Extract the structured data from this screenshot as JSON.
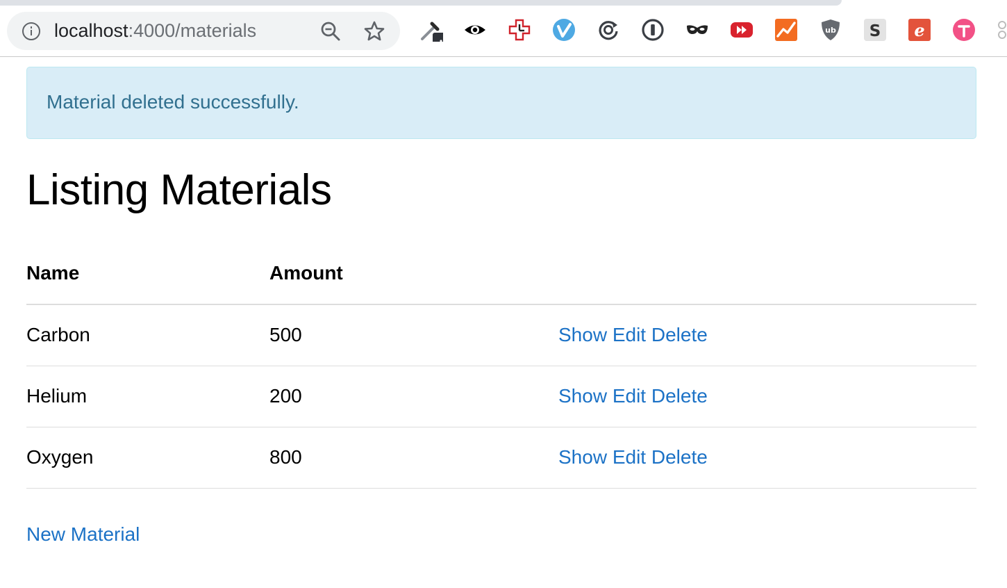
{
  "browser": {
    "url_host": "localhost",
    "url_path": ":4000/materials",
    "extensions": [
      "eyedropper-icon",
      "eye-icon",
      "medical-cross-clock-icon",
      "vimeo-v-icon",
      "sync-refresh-icon",
      "password-manager-icon",
      "mask-icon",
      "youtube-fast-forward-icon",
      "analytics-chart-icon",
      "ublock-shield-icon",
      "s-extension-icon",
      "e-extension-icon",
      "pink-t-extension-icon",
      "puzzle-icon"
    ]
  },
  "flash": {
    "message": "Material deleted successfully.",
    "bg_color": "#d9edf7",
    "text_color": "#31708f"
  },
  "page": {
    "title": "Listing Materials"
  },
  "table": {
    "headers": [
      "Name",
      "Amount"
    ],
    "rows": [
      {
        "name": "Carbon",
        "amount": "500",
        "actions": [
          "Show",
          "Edit",
          "Delete"
        ]
      },
      {
        "name": "Helium",
        "amount": "200",
        "actions": [
          "Show",
          "Edit",
          "Delete"
        ]
      },
      {
        "name": "Oxygen",
        "amount": "800",
        "actions": [
          "Show",
          "Edit",
          "Delete"
        ]
      }
    ]
  },
  "new_link": "New Material",
  "colors": {
    "link": "#1c72c6",
    "divider": "#dddddd"
  }
}
